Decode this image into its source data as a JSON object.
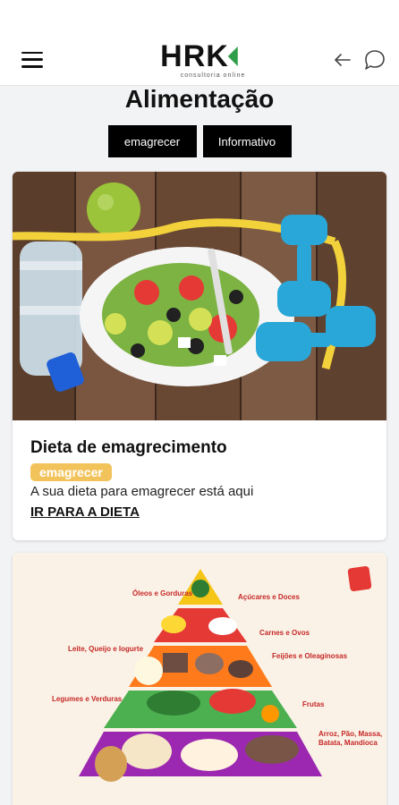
{
  "header": {
    "logo_text": "HRK",
    "logo_subtitle": "consultoria online",
    "menu_icon": "hamburger-menu-icon",
    "back_icon": "arrow-left-icon",
    "chat_icon": "chat-bubble-icon",
    "accent_color": "#2e9e48"
  },
  "page": {
    "title": "Alimentação"
  },
  "filters": [
    {
      "label": "emagrecer"
    },
    {
      "label": "Informativo"
    }
  ],
  "cards": [
    {
      "image": "diet-food-photo",
      "title": "Dieta de emagrecimento",
      "tag": "emagrecer",
      "tag_color": "#f2c35b",
      "description": "A sua dieta para emagrecer está aqui",
      "link": "IR PARA A DIETA"
    },
    {
      "image": "food-pyramid-illustration",
      "pyramid_labels": {
        "oleos": "Óleos e Gorduras",
        "acucares": "Açúcares e Doces",
        "carnes": "Carnes e Ovos",
        "leite": "Leite, Queijo e Iogurte",
        "feijoes": "Feijões e Oleaginosas",
        "legumes": "Legumes e Verduras",
        "frutas": "Frutas",
        "arroz": "Arroz, Pão, Massa, Batata, Mandioca"
      }
    }
  ]
}
